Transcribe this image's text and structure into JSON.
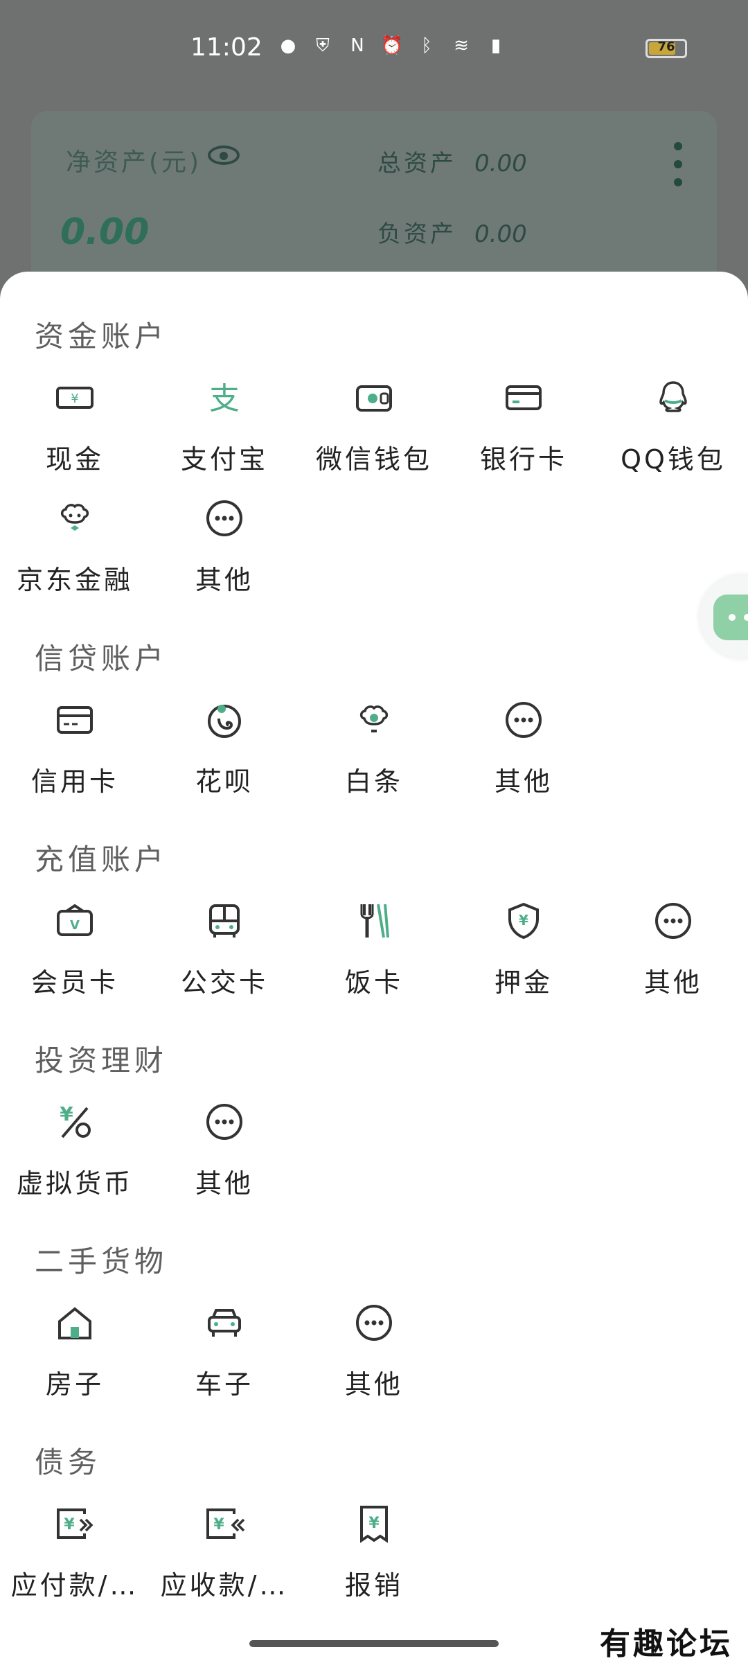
{
  "status": {
    "time": "11:02",
    "battery": "76"
  },
  "asset_card": {
    "net_label": "净资产(元)",
    "net_value": "0.00",
    "total_label": "总资产",
    "total_value": "0.00",
    "liab_label": "负资产",
    "liab_value": "0.00"
  },
  "sections": [
    {
      "title": "资金账户",
      "items": [
        {
          "label": "现金",
          "icon": "cash-icon"
        },
        {
          "label": "支付宝",
          "icon": "alipay-icon"
        },
        {
          "label": "微信钱包",
          "icon": "wallet-icon"
        },
        {
          "label": "银行卡",
          "icon": "bank-card-icon"
        },
        {
          "label": "QQ钱包",
          "icon": "qq-icon"
        },
        {
          "label": "京东金融",
          "icon": "jd-icon"
        },
        {
          "label": "其他",
          "icon": "more-icon"
        }
      ]
    },
    {
      "title": "信贷账户",
      "items": [
        {
          "label": "信用卡",
          "icon": "credit-card-icon"
        },
        {
          "label": "花呗",
          "icon": "huabei-icon"
        },
        {
          "label": "白条",
          "icon": "baitiao-icon"
        },
        {
          "label": "其他",
          "icon": "more-icon"
        }
      ]
    },
    {
      "title": "充值账户",
      "items": [
        {
          "label": "会员卡",
          "icon": "member-card-icon"
        },
        {
          "label": "公交卡",
          "icon": "bus-icon"
        },
        {
          "label": "饭卡",
          "icon": "fork-knife-icon"
        },
        {
          "label": "押金",
          "icon": "deposit-shield-icon"
        },
        {
          "label": "其他",
          "icon": "more-icon"
        }
      ]
    },
    {
      "title": "投资理财",
      "items": [
        {
          "label": "虚拟货币",
          "icon": "crypto-icon"
        },
        {
          "label": "其他",
          "icon": "more-icon"
        }
      ]
    },
    {
      "title": "二手货物",
      "items": [
        {
          "label": "房子",
          "icon": "house-icon"
        },
        {
          "label": "车子",
          "icon": "car-icon"
        },
        {
          "label": "其他",
          "icon": "more-icon"
        }
      ]
    },
    {
      "title": "债务",
      "items": [
        {
          "label": "应付款/…",
          "icon": "payable-icon"
        },
        {
          "label": "应收款/…",
          "icon": "receivable-icon"
        },
        {
          "label": "报销",
          "icon": "reimburse-icon"
        }
      ]
    }
  ],
  "watermark": "有趣论坛",
  "colors": {
    "accent": "#4fae8a",
    "icon_dark": "#333333",
    "fab": "#8fd0a7"
  }
}
